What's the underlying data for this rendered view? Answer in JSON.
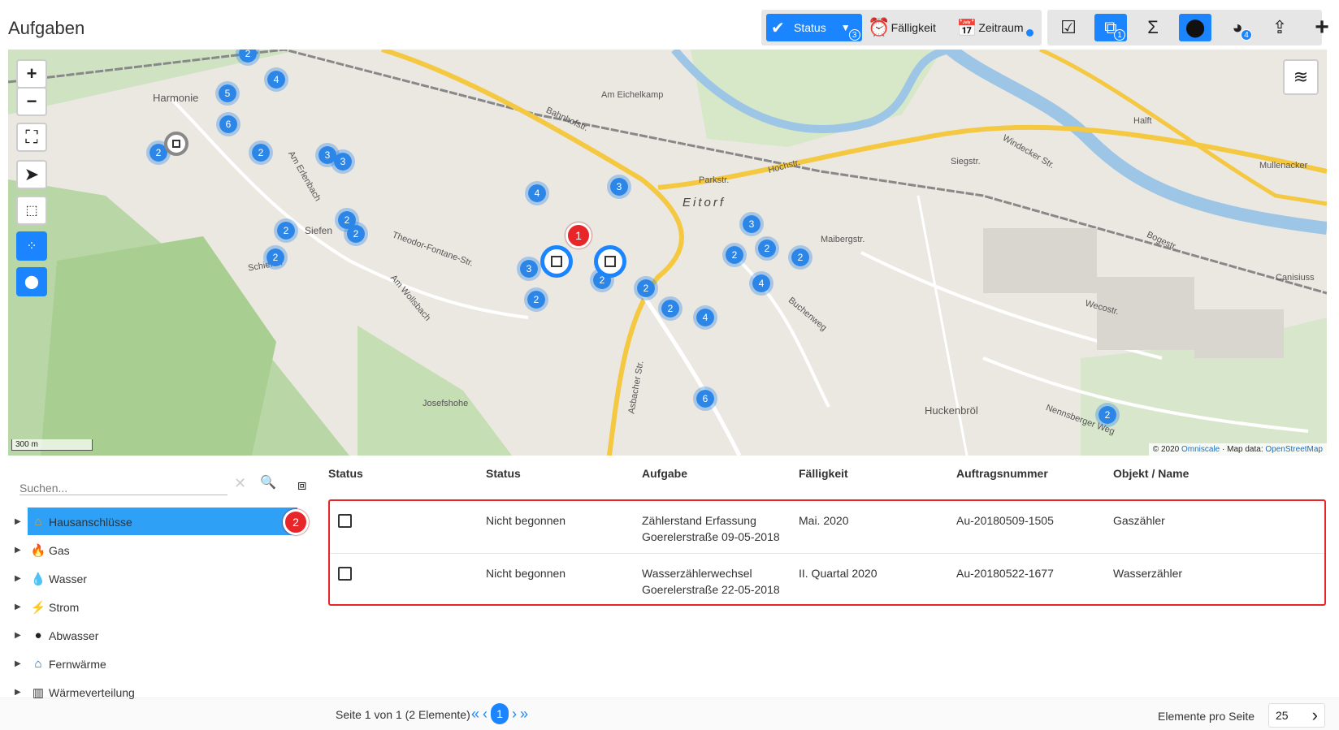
{
  "page": {
    "title": "Aufgaben"
  },
  "toolbar": {
    "status_label": "Status",
    "status_badge": "3",
    "faelligkeit_label": "Fälligkeit",
    "zeitraum_label": "Zeitraum",
    "tree_badge": "1",
    "pie_badge": "4"
  },
  "map": {
    "zoom_in": "+",
    "zoom_out": "−",
    "scale": "300 m",
    "attribution_prefix": "© 2020",
    "attribution_omniscale": "Omniscale",
    "attribution_mid": "· Map data:",
    "attribution_osm": "OpenStreetMap",
    "town_label": "Eitorf",
    "marker1": "1",
    "marker2": "2",
    "clusters": [
      {
        "n": "2"
      },
      {
        "n": "4"
      },
      {
        "n": "5"
      },
      {
        "n": "6"
      },
      {
        "n": "2"
      },
      {
        "n": "2"
      },
      {
        "n": "3"
      },
      {
        "n": "3"
      },
      {
        "n": "2"
      },
      {
        "n": "2"
      },
      {
        "n": "2"
      },
      {
        "n": "2"
      },
      {
        "n": "4"
      },
      {
        "n": "3"
      },
      {
        "n": "3"
      },
      {
        "n": "2"
      },
      {
        "n": "2"
      },
      {
        "n": "2"
      },
      {
        "n": "2"
      },
      {
        "n": "4"
      },
      {
        "n": "3"
      },
      {
        "n": "2"
      },
      {
        "n": "2"
      },
      {
        "n": "2"
      },
      {
        "n": "4"
      },
      {
        "n": "6"
      },
      {
        "n": "2"
      }
    ],
    "street_labels": [
      "Harmonie",
      "Am Erlenbach",
      "Theodor-Fontane-Str.",
      "Am Wollsbach",
      "Josefshohe",
      "Bahnhofstr.",
      "Am Eichelkamp",
      "Parkstr.",
      "Hochstr.",
      "Siegstr.",
      "Windecker Str.",
      "Halft",
      "Mullenacker",
      "Huckenbröl",
      "Wecostr.",
      "Canisiuss",
      "Bogestr.",
      "Maibergstr.",
      "Buchenweg",
      "Nennsberger Weg",
      "Siefen",
      "Schiefen",
      "Asbacher Str."
    ]
  },
  "sidebar": {
    "search_placeholder": "Suchen...",
    "items": [
      {
        "label": "Hausanschlüsse",
        "icon": "house-icon",
        "color": "#e8a020"
      },
      {
        "label": "Gas",
        "icon": "flame-icon",
        "color": "#e8262a"
      },
      {
        "label": "Wasser",
        "icon": "drop-icon",
        "color": "#2ea0f5"
      },
      {
        "label": "Strom",
        "icon": "bolt-icon",
        "color": "#e8c020"
      },
      {
        "label": "Abwasser",
        "icon": "drop-icon",
        "color": "#222222"
      },
      {
        "label": "Fernwärme",
        "icon": "house-icon",
        "color": "#2060a0"
      },
      {
        "label": "Wärmeverteilung",
        "icon": "radiator-icon",
        "color": "#333333"
      }
    ]
  },
  "table": {
    "columns": [
      "Status",
      "Status",
      "Aufgabe",
      "Fälligkeit",
      "Auftragsnummer",
      "Objekt / Name"
    ],
    "rows": [
      {
        "status": "Nicht begonnen",
        "aufgabe1": "Zählerstand Erfassung",
        "aufgabe2": "Goerelerstraße 09-05-2018",
        "faelligkeit": "Mai. 2020",
        "auftrag": "Au-20180509-1505",
        "objekt": "Gaszähler"
      },
      {
        "status": "Nicht begonnen",
        "aufgabe1": "Wasserzählerwechsel",
        "aufgabe2": "Goerelerstraße 22-05-2018",
        "faelligkeit": "II. Quartal 2020",
        "auftrag": "Au-20180522-1677",
        "objekt": "Wasserzähler"
      }
    ]
  },
  "footer": {
    "page_info": "Seite 1 von 1 (2 Elemente)",
    "current_page": "1",
    "per_page_label": "Elemente pro Seite",
    "per_page_value": "25"
  },
  "colors": {
    "accent": "#1a85ff",
    "highlight": "#e8262a"
  }
}
